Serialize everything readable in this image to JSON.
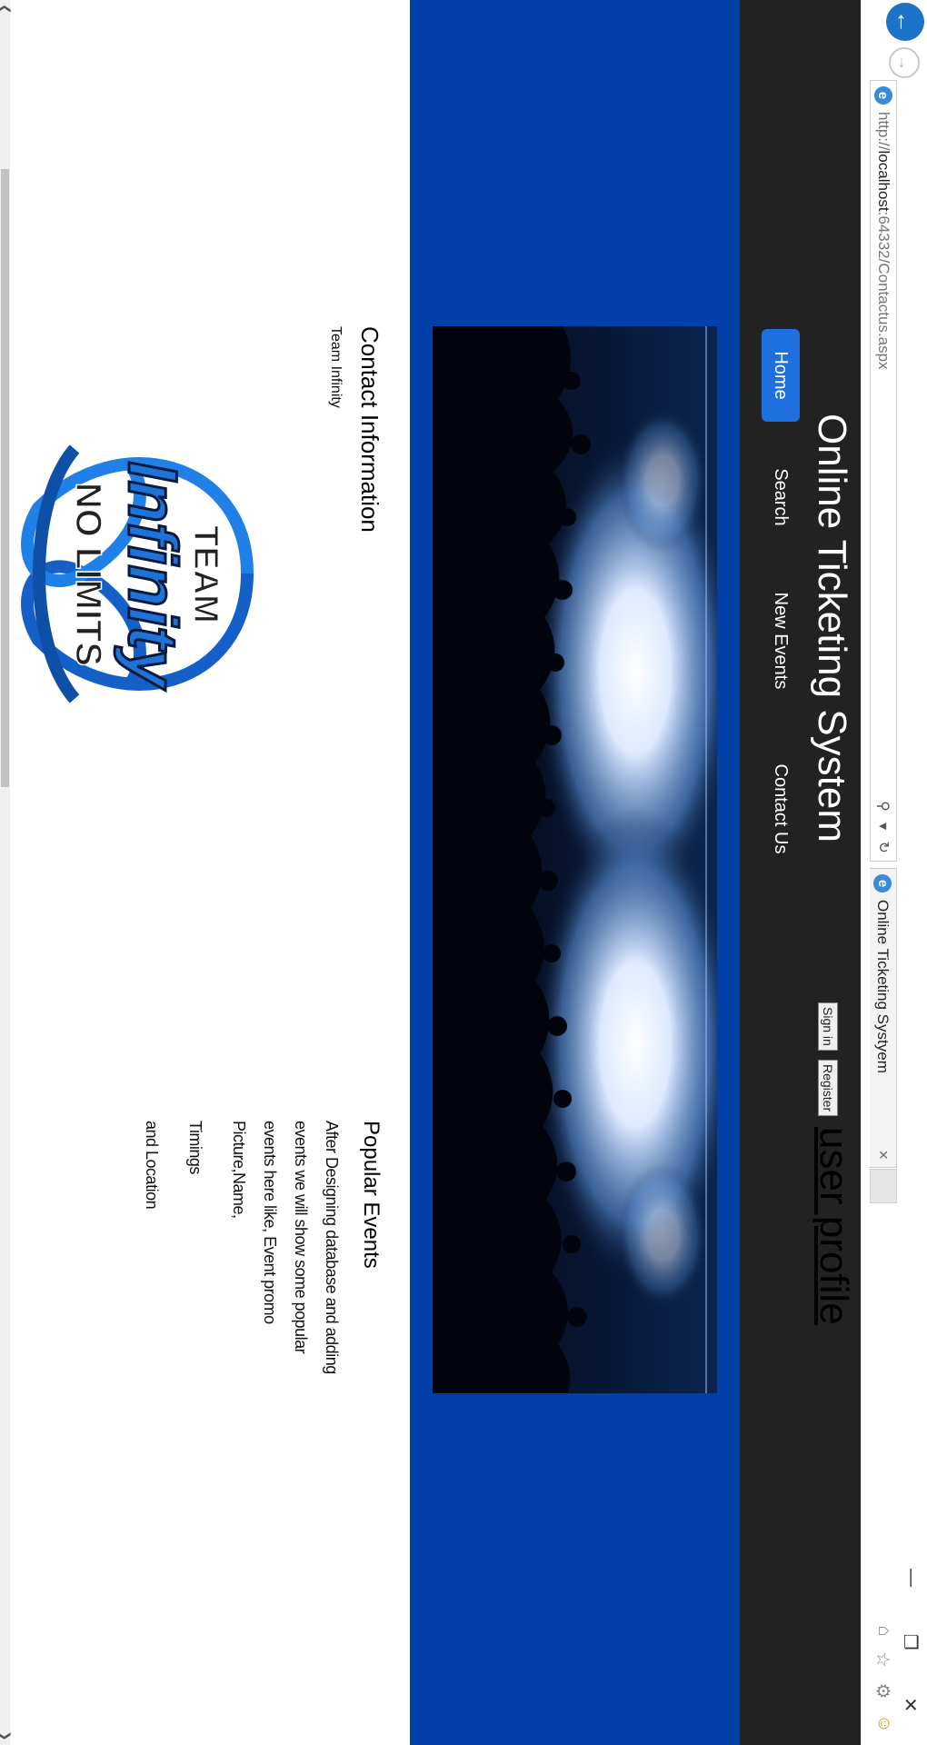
{
  "browser": {
    "url_prefix": "http://",
    "url_domain": "localhost",
    "url_rest": ":64332/Contactus.aspx",
    "tab_title": "Online Ticketing Systyem",
    "tab_close": "×",
    "win_controls": [
      "—",
      "❐",
      "✕"
    ],
    "icons": [
      "back-icon",
      "forward-icon",
      "ie-icon",
      "search-icon",
      "refresh-icon",
      "home-icon",
      "star-icon",
      "gear-icon",
      "smiley-icon"
    ]
  },
  "header": {
    "title": "Online Ticketing System",
    "signin_label": "Sign in",
    "register_label": "Register",
    "profile_link": "user profile",
    "nav": [
      "Home",
      "Search",
      "New Events",
      "Contact Us"
    ]
  },
  "contact": {
    "title": "Contact Information",
    "team": "Team Infinity"
  },
  "logo": {
    "top": "TEAM",
    "main": "Infinity",
    "bottom": "NO LIMITS"
  },
  "popular": {
    "title": "Popular Events",
    "lines": [
      "After Designing database and adding",
      "events we will show some popular",
      "events here like, Event promo",
      "Picture,Name,",
      "Timings",
      "and Location"
    ]
  },
  "colors": {
    "header_bg": "#222222",
    "hero_bg": "#0140a8",
    "nav_active": "#1e6fe0"
  }
}
